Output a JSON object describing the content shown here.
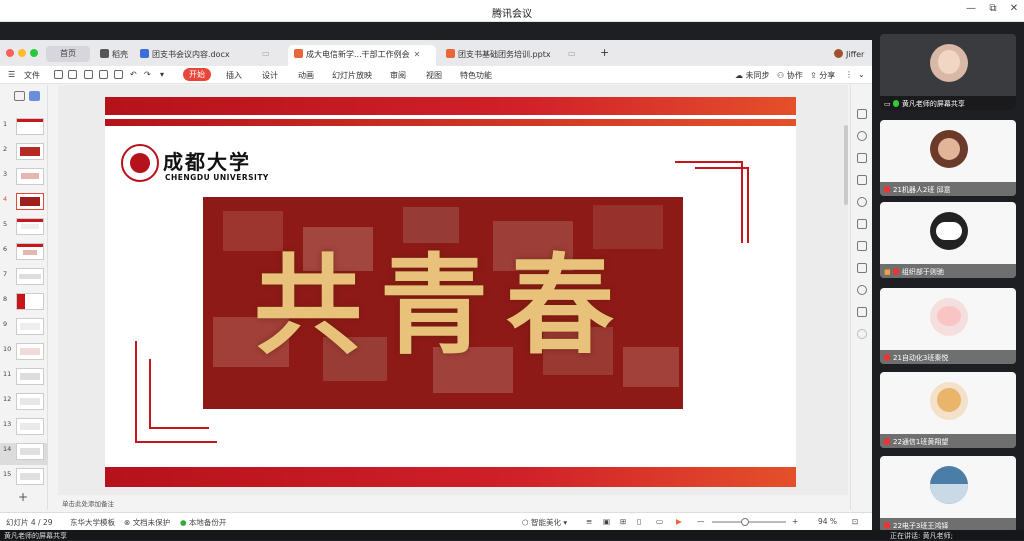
{
  "window": {
    "title": "腾讯会议",
    "min": "—",
    "max": "⧉",
    "close": "✕"
  },
  "tabs": {
    "home": "首页",
    "items": [
      {
        "label": "稻壳",
        "color": "#555"
      },
      {
        "label": "团支书会议内容.docx",
        "color": "#3c6fd8"
      },
      {
        "label": "成大电信新学...干部工作例会",
        "color": "#e8663a"
      },
      {
        "label": "团支书基础团务培训.pptx",
        "color": "#e8663a"
      }
    ],
    "add": "+",
    "user": "Jiffer"
  },
  "menu": {
    "file": "文件",
    "start": "开始",
    "items": [
      "插入",
      "设计",
      "动画",
      "幻灯片放映",
      "审阅",
      "视图",
      "特色功能"
    ],
    "sync": "未同步",
    "collab": "协作",
    "share": "分享"
  },
  "thumbnails": {
    "numbers": [
      "1",
      "2",
      "3",
      "4",
      "5",
      "6",
      "7",
      "8",
      "9",
      "10",
      "11",
      "12",
      "13",
      "14",
      "15"
    ],
    "selected": "4",
    "add": "+"
  },
  "slide": {
    "university_cn": "成都大学",
    "university_en": "CHENGDU UNIVERSITY",
    "headline": "共青春",
    "colors": {
      "red": "#c8161d",
      "gold": "#e8c27a",
      "dark_red": "#8e1a17"
    }
  },
  "notes": {
    "placeholder": "单击此处添加备注"
  },
  "status": {
    "slide_count": "幻灯片 4 / 29",
    "template": "东华大学模板",
    "doc_protect": "文档未保护",
    "backup": "本地备份开",
    "smart": "智能美化",
    "zoom": "94 %",
    "zoom_minus": "—",
    "zoom_plus": "+",
    "zoom_level": 0.45
  },
  "participants": [
    {
      "name": "黄凡老师的屏幕共享",
      "mic": "on"
    },
    {
      "name": "21机器人2班 邱意",
      "mic": "off"
    },
    {
      "name": "组织部于则驰",
      "mic": "off"
    },
    {
      "name": "21自动化3班秦悦",
      "mic": "off"
    },
    {
      "name": "22通信1班黄翔望",
      "mic": "off"
    },
    {
      "name": "22电子3班王鸿铎",
      "mic": "off"
    }
  ],
  "bottom": {
    "left": "黄凡老师的屏幕共享",
    "right": "正在讲话: 黄凡老师;"
  }
}
